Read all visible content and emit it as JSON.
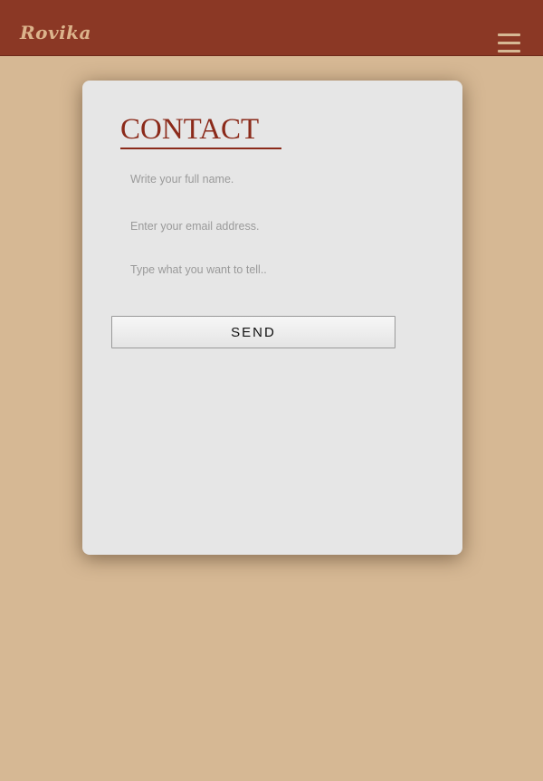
{
  "header": {
    "brand": "Rovika",
    "menu_icon": "hamburger-menu-icon"
  },
  "contact": {
    "title": "CONTACT",
    "name_placeholder": "Write your full name.",
    "email_placeholder": "Enter your email address.",
    "message_placeholder": "Type what you want to tell..",
    "send_label": "SEND"
  },
  "colors": {
    "header_bg": "#8b3825",
    "page_bg": "#d6b894",
    "card_bg": "#e6e6e6",
    "accent": "#8b2a1a"
  }
}
